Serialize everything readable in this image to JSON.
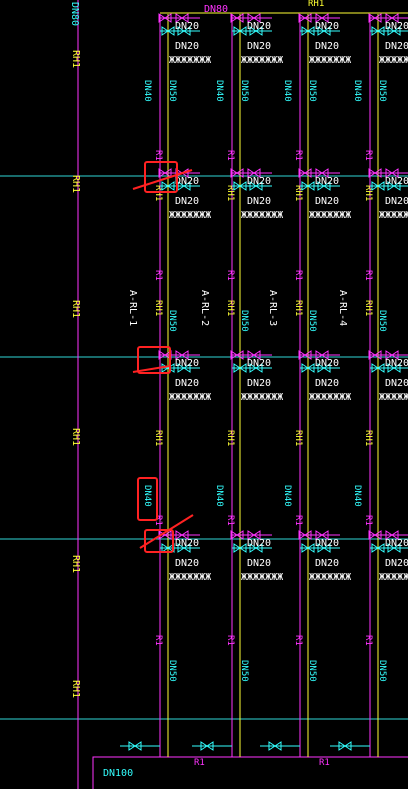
{
  "colors": {
    "background": "#000000",
    "magenta": "#ff33ff",
    "yellow": "#ffff33",
    "cyan": "#33ffff",
    "white": "#ffffff",
    "red": "#ff2222",
    "grid": "#2fd6d6"
  },
  "riser_labels": [
    "A-RL-1",
    "A-RL-2",
    "A-RL-3",
    "A-RL-4"
  ],
  "pipe_labels": {
    "rh1": "RH1",
    "r1": "R1",
    "dn20": "DN20",
    "dn40": "DN40",
    "dn50": "DN50",
    "dn80": "DN80",
    "dn100": "DN100",
    "fixture": "ЖЖЖЖЖЖЖ"
  }
}
